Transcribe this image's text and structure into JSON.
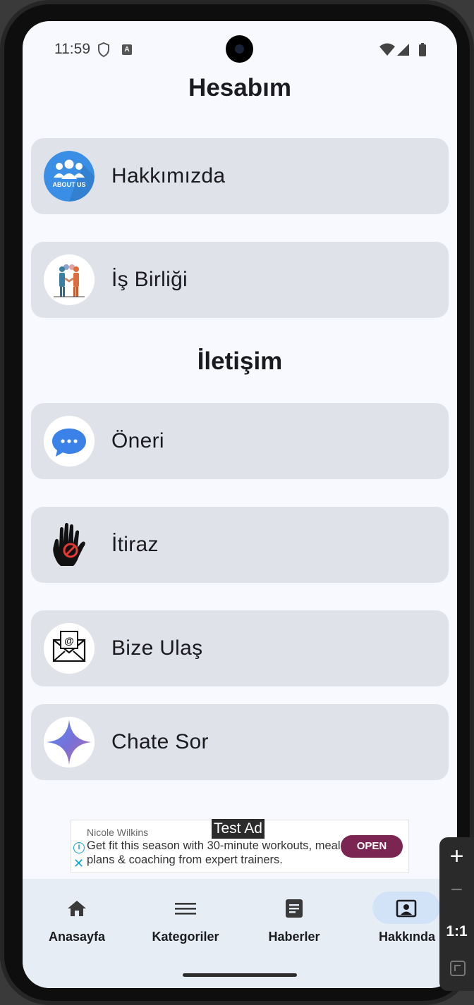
{
  "status_bar": {
    "time": "11:59"
  },
  "page_title": "Hesabım",
  "account_items": [
    {
      "label": "Hakkımızda",
      "icon": "about-us-icon",
      "badge": "ABOUT US"
    },
    {
      "label": "İş Birliği",
      "icon": "handshake-icon"
    }
  ],
  "contact_title": "İletişim",
  "contact_items": [
    {
      "label": "Öneri",
      "icon": "chat-bubble-icon"
    },
    {
      "label": "İtiraz",
      "icon": "stop-hand-icon"
    },
    {
      "label": "Bize Ulaş",
      "icon": "envelope-icon"
    },
    {
      "label": "Chate Sor",
      "icon": "sparkle-icon"
    }
  ],
  "ad": {
    "test_label": "Test Ad",
    "advertiser": "Nicole Wilkins",
    "text": "Get fit this season with 30-minute workouts, meal plans & coaching from expert trainers.",
    "cta": "OPEN"
  },
  "bottom_nav": {
    "items": [
      {
        "label": "Anasayfa",
        "icon": "home-icon"
      },
      {
        "label": "Kategoriler",
        "icon": "menu-icon"
      },
      {
        "label": "Haberler",
        "icon": "article-icon"
      },
      {
        "label": "Hakkında",
        "icon": "account-box-icon",
        "active": true
      }
    ]
  },
  "emulator_zoom": {
    "plus": "+",
    "minus": "−",
    "ratio": "1:1"
  },
  "colors": {
    "background": "#f7f9fe",
    "card": "#dfe3e9",
    "nav_bg": "#e6edf5",
    "active_pill": "#d2e3f7",
    "ad_cta": "#7b2553"
  }
}
